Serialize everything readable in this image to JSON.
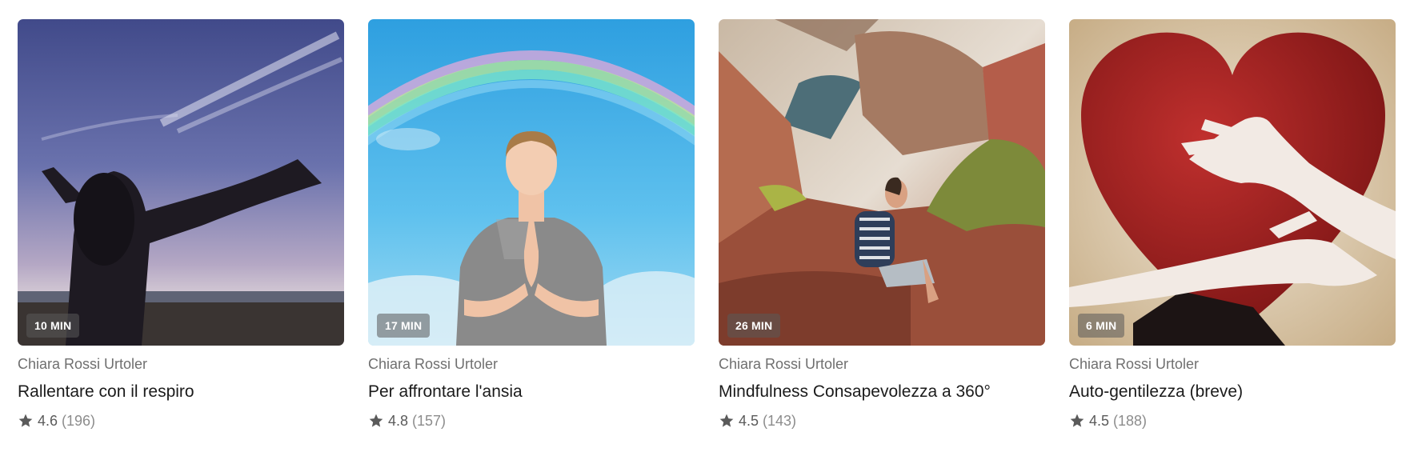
{
  "cards": [
    {
      "duration": "10 MIN",
      "author": "Chiara Rossi Urtoler",
      "title": "Rallentare con il respiro",
      "rating": "4.6",
      "reviews": "(196)",
      "image": "woman-arms-outstretched-at-beach-sunset"
    },
    {
      "duration": "17 MIN",
      "author": "Chiara Rossi Urtoler",
      "title": "Per affrontare l'ansia",
      "rating": "4.8",
      "reviews": "(157)",
      "image": "woman-meditating-under-rainbow"
    },
    {
      "duration": "26 MIN",
      "author": "Chiara Rossi Urtoler",
      "title": "Mindfulness Consapevolezza a 360°",
      "rating": "4.5",
      "reviews": "(143)",
      "image": "woman-sitting-on-canyon-rocks"
    },
    {
      "duration": "6 MIN",
      "author": "Chiara Rossi Urtoler",
      "title": "Auto-gentilezza (breve)",
      "rating": "4.5",
      "reviews": "(188)",
      "image": "arms-hugging-red-heart"
    }
  ],
  "icons": {
    "rating": "star-icon"
  },
  "colors": {
    "badge_bg": "#5a5a5a",
    "title_text": "#1b1b1b",
    "author_text": "#6f6f6f",
    "star": "#5a5a5a"
  }
}
